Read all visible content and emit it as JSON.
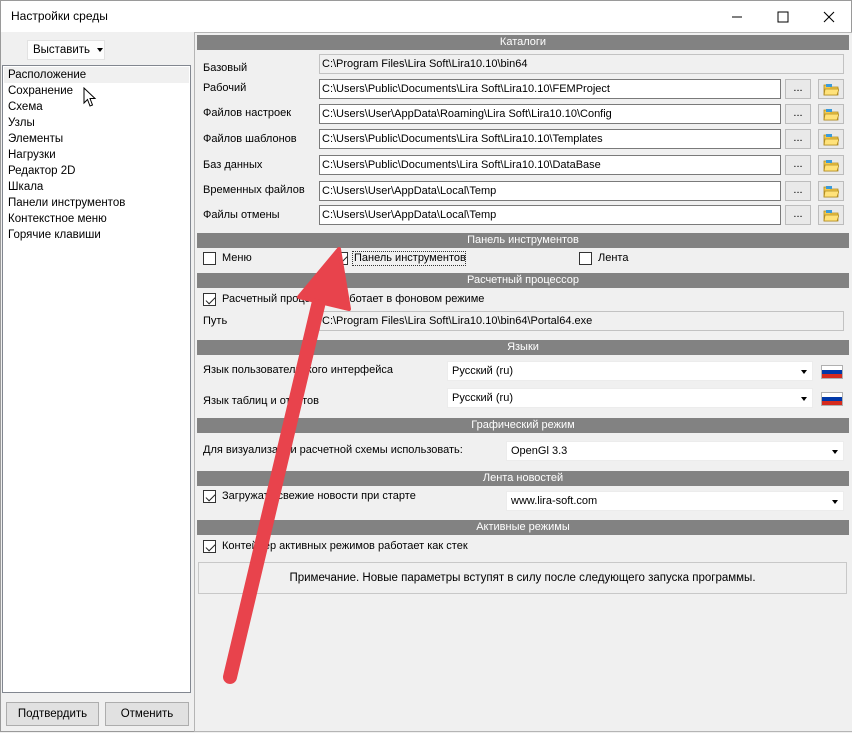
{
  "window": {
    "title": "Настройки среды"
  },
  "left": {
    "insert_label": "Выставить",
    "items": [
      "Расположение",
      "Сохранение",
      "Схема",
      "Узлы",
      "Элементы",
      "Нагрузки",
      "Редактор 2D",
      "Шкала",
      "Панели инструментов",
      "Контекстное меню",
      "Горячие клавиши"
    ],
    "selected_index": 0,
    "confirm_label": "Подтвердить",
    "cancel_label": "Отменить"
  },
  "catalogs": {
    "header": "Каталоги",
    "rows": [
      {
        "label": "Базовый",
        "value": "C:\\Program Files\\Lira Soft\\Lira10.10\\bin64"
      },
      {
        "label": "Рабочий",
        "value": "C:\\Users\\Public\\Documents\\Lira Soft\\Lira10.10\\FEMProject"
      },
      {
        "label": "Файлов настроек",
        "value": "C:\\Users\\User\\AppData\\Roaming\\Lira Soft\\Lira10.10\\Config"
      },
      {
        "label": "Файлов шаблонов",
        "value": "C:\\Users\\Public\\Documents\\Lira Soft\\Lira10.10\\Templates"
      },
      {
        "label": "Баз данных",
        "value": "C:\\Users\\Public\\Documents\\Lira Soft\\Lira10.10\\DataBase"
      },
      {
        "label": "Временных файлов",
        "value": "C:\\Users\\User\\AppData\\Local\\Temp"
      },
      {
        "label": "Файлы отмены",
        "value": "C:\\Users\\User\\AppData\\Local\\Temp"
      }
    ],
    "browse_label": "..."
  },
  "toolbar_panel": {
    "header": "Панель инструментов",
    "menu_label": "Меню",
    "menu_checked": false,
    "toolbar_label": "Панель инструментов",
    "toolbar_checked": true,
    "ribbon_label": "Лента",
    "ribbon_checked": false
  },
  "processor": {
    "header": "Расчетный процессор",
    "background_label": "Расчетный процессор работает в фоновом режиме",
    "background_checked": true,
    "path_label": "Путь",
    "path_value": "C:\\Program Files\\Lira Soft\\Lira10.10\\bin64\\Portal64.exe"
  },
  "languages": {
    "header": "Языки",
    "ui_label": "Язык пользовательского интерфейса",
    "ui_value": "Русский (ru)",
    "tables_label": "Язык таблиц и отчетов",
    "tables_value": "Русский (ru)"
  },
  "graphics": {
    "header": "Графический режим",
    "label": "Для визуализации расчетной схемы использовать:",
    "value": "OpenGl 3.3"
  },
  "news": {
    "header": "Лента новостей",
    "load_label": "Загружать свежие новости при старте",
    "load_checked": true,
    "source_value": "www.lira-soft.com"
  },
  "active_modes": {
    "header": "Активные режимы",
    "stack_label": "Контейнер активных режимов работает как стек",
    "stack_checked": true
  },
  "note": "Примечание. Новые параметры вступят в силу после следующего запуска программы.",
  "colors": {
    "section_header": "#828282",
    "annotation_arrow": "#e8434c"
  }
}
